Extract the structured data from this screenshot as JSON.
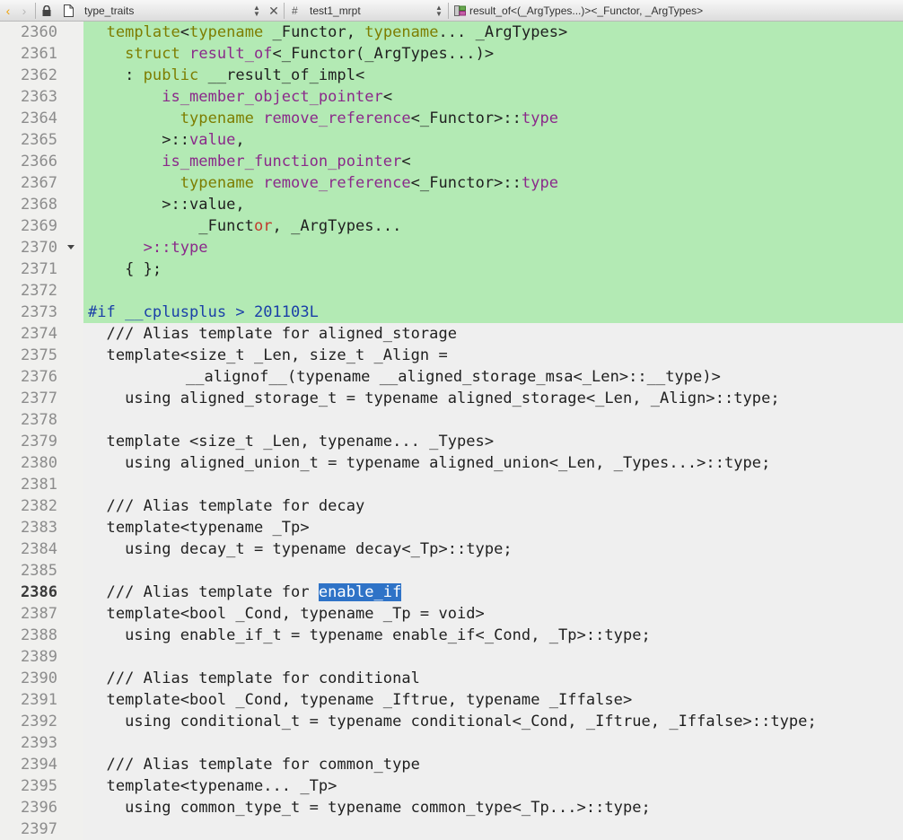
{
  "toolbar": {
    "back_glyph": "‹",
    "forward_glyph": "›",
    "file_name": "type_traits",
    "close_glyph": "✕",
    "symbol_prefix": "#",
    "symbol_name": "test1_mrpt",
    "function_signature": "result_of<(_ArgTypes...)><_Functor, _ArgTypes>",
    "icons": [
      "chevron-left-icon",
      "chevron-right-icon",
      "lock-icon",
      "document-icon",
      "close-icon",
      "class-icon"
    ]
  },
  "editor": {
    "highlight_color": "#b3eab4",
    "selection_color": "#2f73c7",
    "current_line": "2386",
    "lines": [
      {
        "n": "2360"
      },
      {
        "n": "2361"
      },
      {
        "n": "2362"
      },
      {
        "n": "2363"
      },
      {
        "n": "2364"
      },
      {
        "n": "2365"
      },
      {
        "n": "2366"
      },
      {
        "n": "2367"
      },
      {
        "n": "2368"
      },
      {
        "n": "2369"
      },
      {
        "n": "2370"
      },
      {
        "n": "2371"
      },
      {
        "n": "2372"
      },
      {
        "n": "2373"
      },
      {
        "n": "2374"
      },
      {
        "n": "2375"
      },
      {
        "n": "2376"
      },
      {
        "n": "2377"
      },
      {
        "n": "2378"
      },
      {
        "n": "2379"
      },
      {
        "n": "2380"
      },
      {
        "n": "2381"
      },
      {
        "n": "2382"
      },
      {
        "n": "2383"
      },
      {
        "n": "2384"
      },
      {
        "n": "2385"
      },
      {
        "n": "2386"
      },
      {
        "n": "2387"
      },
      {
        "n": "2388"
      },
      {
        "n": "2389"
      },
      {
        "n": "2390"
      },
      {
        "n": "2391"
      },
      {
        "n": "2392"
      },
      {
        "n": "2393"
      },
      {
        "n": "2394"
      },
      {
        "n": "2395"
      },
      {
        "n": "2396"
      },
      {
        "n": "2397"
      }
    ],
    "code": {
      "l2360": {
        "a": "  ",
        "b": "template",
        "c": "<",
        "d": "typename",
        "e": " _Functor, ",
        "f": "typename",
        "g": "... _ArgTypes>"
      },
      "l2361": {
        "a": "    ",
        "b": "struct",
        "c": " ",
        "d": "result_of",
        "e": "<_Functor(_ArgTypes...)>"
      },
      "l2362": {
        "a": "    : ",
        "b": "public",
        "c": " __result_of_impl<"
      },
      "l2363": {
        "a": "        ",
        "b": "is_member_object_pointer",
        "c": "<"
      },
      "l2364": {
        "a": "          ",
        "b": "typename",
        "c": " ",
        "d": "remove_reference",
        "e": "<_Functor>::",
        "f": "type"
      },
      "l2365": {
        "a": "        >::",
        "b": "value",
        "c": ","
      },
      "l2366": {
        "a": "        ",
        "b": "is_member_function_pointer",
        "c": "<"
      },
      "l2367": {
        "a": "          ",
        "b": "typename",
        "c": " ",
        "d": "remove_reference",
        "e": "<_Functor>::",
        "f": "type"
      },
      "l2368": {
        "a": "        >::value,"
      },
      "l2369": {
        "a": "            _Funct",
        "b": "or",
        "c": ", _ArgTypes..."
      },
      "l2370": {
        "a": "      ",
        "b": ">::type"
      },
      "l2371": {
        "a": "    { };"
      },
      "l2373": {
        "a": "#if",
        "b": " __cplusplus > 201103L"
      },
      "l2374": {
        "a": "  /// Alias template for aligned_storage"
      },
      "l2375": {
        "a": "  template<size_t _Len, size_t _Align ="
      },
      "l2376": {
        "a": "       __alignof__(typename __aligned_storage_msa<_Len>::__type)>"
      },
      "l2377": {
        "a": "    using aligned_storage_t = typename aligned_storage<_Len, _Align>::type;"
      },
      "l2379": {
        "a": "  template <size_t _Len, typename... _Types>"
      },
      "l2380": {
        "a": "    using aligned_union_t = typename aligned_union<_Len, _Types...>::type;"
      },
      "l2382": {
        "a": "  /// Alias template for decay"
      },
      "l2383": {
        "a": "  template<typename _Tp>"
      },
      "l2384": {
        "a": "    using decay_t = typename decay<_Tp>::type;"
      },
      "l2386": {
        "a": "  /// Alias template for ",
        "b": "enable_if"
      },
      "l2387": {
        "a": "  template<bool _Cond, typename _Tp = void>"
      },
      "l2388": {
        "a": "    using enable_if_t = typename enable_if<_Cond, _Tp>::type;"
      },
      "l2390": {
        "a": "  /// Alias template for conditional"
      },
      "l2391": {
        "a": "  template<bool _Cond, typename _Iftrue, typename _Iffalse>"
      },
      "l2392": {
        "a": "    using conditional_t = typename conditional<_Cond, _Iftrue, _Iffalse>::type;"
      },
      "l2394": {
        "a": "  /// Alias template for common_type"
      },
      "l2395": {
        "a": "  template<typename... _Tp>"
      },
      "l2396": {
        "a": "    using common_type_t = typename common_type<_Tp...>::type;"
      }
    }
  }
}
